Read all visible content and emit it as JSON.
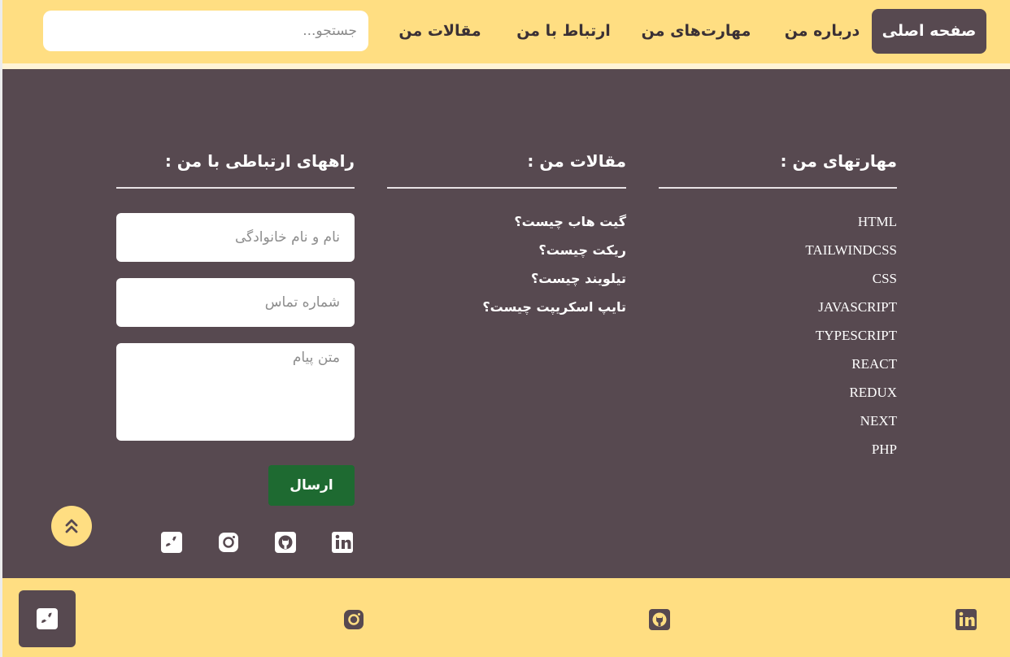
{
  "nav": {
    "links": [
      {
        "label": "صفحه اصلی",
        "active": true
      },
      {
        "label": "درباره من"
      },
      {
        "label": "مهارت‌های من"
      },
      {
        "label": "ارتباط با من"
      },
      {
        "label": "مقالات من"
      }
    ],
    "search_placeholder": "جستجو..."
  },
  "skills": {
    "title": "مهارتهای من :",
    "items": [
      "HTML",
      "TAILWINDCSS",
      "CSS",
      "JAVASCRIPT",
      "TYPESCRIPT",
      "REACT",
      "REDUX",
      "NEXT",
      "PHP"
    ]
  },
  "articles": {
    "title": "مقالات من :",
    "items": [
      "گیت هاب چیست؟",
      "ریکت چیست؟",
      "تیلویند چیست؟",
      "تایپ اسکریپت چیست؟"
    ]
  },
  "contact": {
    "title": "راههای ارتباطی با من :",
    "name_placeholder": "نام و نام خانوادگی",
    "phone_placeholder": "شماره تماس",
    "message_placeholder": "متن پیام",
    "send_label": "ارسال",
    "social_icons": [
      "linkedin-icon",
      "github-icon",
      "instagram-icon",
      "phone-icon"
    ]
  },
  "bottom_bar": {
    "icons": [
      "phone-icon",
      "instagram-icon",
      "github-icon",
      "linkedin-icon"
    ]
  },
  "colors": {
    "accent": "#ffde82",
    "panel": "#574950",
    "send": "#1e6a31"
  }
}
